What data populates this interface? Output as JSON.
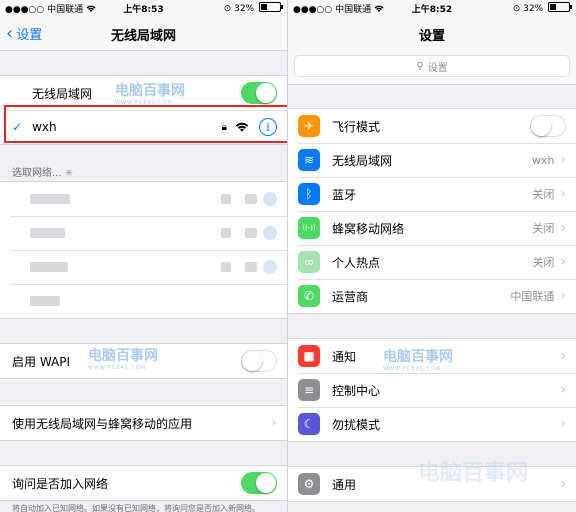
{
  "left": {
    "status": {
      "carrier": "中国联通",
      "time": "上午8:53",
      "battery": "32%",
      "battery_level": 0.32
    },
    "nav": {
      "back_label": "设置",
      "title": "无线局域网"
    },
    "wlan": {
      "label": "无线局域网",
      "enabled": true
    },
    "connected": {
      "ssid": "wxh"
    },
    "choose_network": {
      "header": "选取网络..."
    },
    "wapi": {
      "label": "启用 WAPI",
      "enabled": false
    },
    "apps_using_wlan": {
      "label": "使用无线局域网与蜂窝移动的应用"
    },
    "ask_to_join": {
      "label": "询问是否加入网络",
      "enabled": true,
      "footnote": "将自动加入已知网络。如果没有已知网络，将询问您是否加入新网络。"
    }
  },
  "right": {
    "status": {
      "carrier": "中国联通",
      "time": "上午8:52",
      "battery": "32%",
      "battery_level": 0.32
    },
    "nav": {
      "title": "设置"
    },
    "search": {
      "placeholder": "设置"
    },
    "group1": [
      {
        "label": "飞行模式",
        "icon": "airplane-icon",
        "color": "#ff9500",
        "value": "",
        "toggle": "off"
      },
      {
        "label": "无线局域网",
        "icon": "wifi-icon",
        "color": "#007aff",
        "value": "wxh"
      },
      {
        "label": "蓝牙",
        "icon": "bluetooth-icon",
        "color": "#007aff",
        "value": "关闭"
      },
      {
        "label": "蜂窝移动网络",
        "icon": "cellular-icon",
        "color": "#4cd964",
        "value": "关闭"
      },
      {
        "label": "个人热点",
        "icon": "hotspot-icon",
        "color": "#a8e1b2",
        "value": "关闭"
      },
      {
        "label": "运营商",
        "icon": "phone-icon",
        "color": "#4cd964",
        "value": "中国联通"
      }
    ],
    "group2": [
      {
        "label": "通知",
        "icon": "notifications-icon",
        "color": "#ff3b30"
      },
      {
        "label": "控制中心",
        "icon": "control-center-icon",
        "color": "#8e8e93"
      },
      {
        "label": "勿扰模式",
        "icon": "moon-icon",
        "color": "#5856d6"
      }
    ],
    "group3": [
      {
        "label": "通用",
        "icon": "gear-icon",
        "color": "#8e8e93"
      }
    ]
  },
  "watermark": {
    "text": "电脑百事网",
    "sub": "WWW.PC841.COM"
  },
  "colors": {
    "accent": "#0a7aff",
    "switch_on": "#4cd964",
    "highlight": "#e8232c"
  }
}
